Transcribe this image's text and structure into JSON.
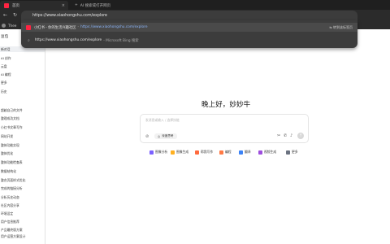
{
  "browser": {
    "tabs": [
      {
        "label": "首页",
        "active": true
      },
      {
        "label": "AI 搜索或打开网页",
        "active": false
      }
    ],
    "address": "https://www.xiaohongshu.com/explore",
    "bookmark_label": "Thee"
  },
  "suggestions": [
    {
      "title": "小红书 - 你的生活兴趣社区",
      "sep": "-",
      "url": "https://www.xiaohongshu.com/explore",
      "action": "转到该标签页"
    },
    {
      "url": "https://www.xiaohongshu.com/explore",
      "desc": "- Microsoft Bing 搜索"
    }
  ],
  "sidebar": {
    "title": "豆包",
    "items": [
      {
        "label": "新对话",
        "active": true
      },
      {
        "label": "AI 创作"
      },
      {
        "label": "云盘"
      },
      {
        "label": "AI 编程"
      },
      {
        "label": "更多"
      },
      {
        "label": "历史"
      },
      {
        "label": "超越自己的文件"
      },
      {
        "label": "整理成功文档"
      },
      {
        "label": "小红书文章写作"
      },
      {
        "label": "网站开发"
      },
      {
        "label": "整体功能实现"
      },
      {
        "label": "整体优化"
      },
      {
        "label": "整体功能检查表"
      },
      {
        "label": "数据结构化"
      },
      {
        "label": "整合页面样式优化"
      },
      {
        "label": "完成的链接分析"
      },
      {
        "label": "分析历史动态"
      },
      {
        "label": "社区内容分享"
      },
      {
        "label": "环境设定"
      },
      {
        "label": "用户信息推荐"
      },
      {
        "label": "产品最终版方案"
      },
      {
        "label": "用户运营方案设计"
      },
      {
        "label": "数据优化与资源推荐"
      },
      {
        "label": "完善内容搜索功能"
      },
      {
        "label": "发布整合社区分享"
      }
    ]
  },
  "main": {
    "greeting": "晚上好，妙妙牛",
    "input_placeholder": "发消息或输入 / 选择技能",
    "mode_label": "深度思考",
    "send_icon": "up-arrow-icon",
    "quick_actions": [
      {
        "label": "图像分析",
        "color": "#7b61ff"
      },
      {
        "label": "图像生成",
        "color": "#ffb020"
      },
      {
        "label": "帮我写作",
        "color": "#ff6a3d"
      },
      {
        "label": "编程",
        "color": "#ff7a45"
      },
      {
        "label": "翻译",
        "color": "#3b82f6"
      },
      {
        "label": "视频生成",
        "color": "#9d4edd"
      },
      {
        "label": "更多",
        "color": "#6b7280"
      }
    ]
  }
}
